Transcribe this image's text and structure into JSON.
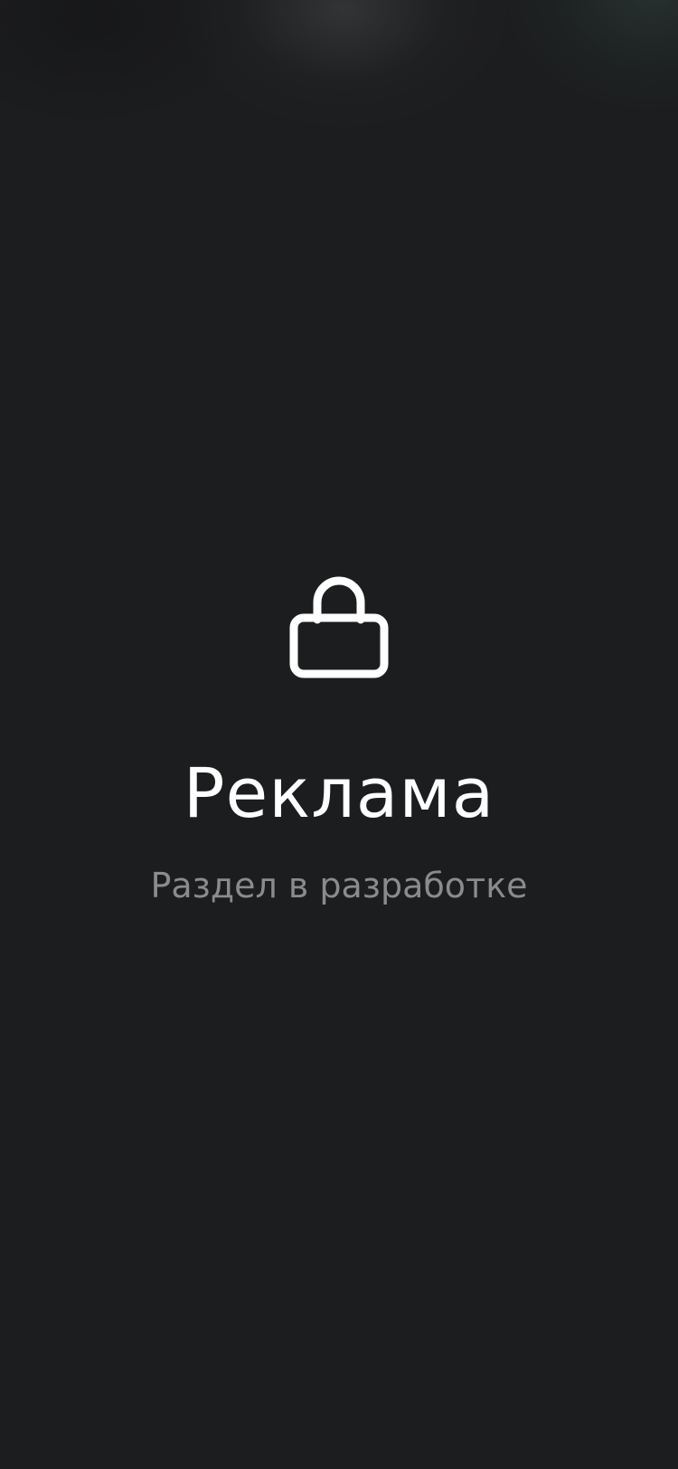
{
  "screen": {
    "title": "Реклама",
    "subtitle": "Раздел в разработке",
    "icon": "lock-icon"
  },
  "colors": {
    "background": "#1c1d1f",
    "title": "#ffffff",
    "subtitle": "#8a8b8d"
  }
}
